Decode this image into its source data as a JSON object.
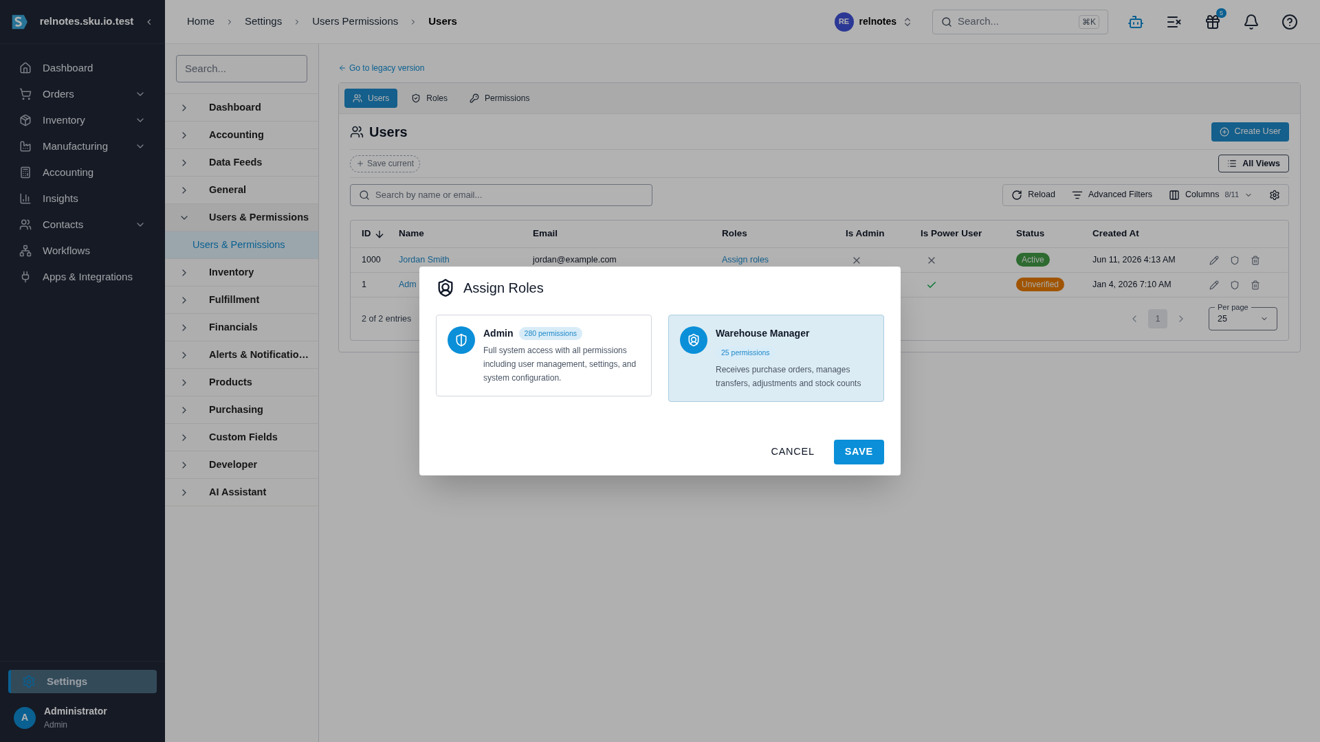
{
  "app": {
    "name": "relnotes.sku.io.test"
  },
  "nav": [
    {
      "label": "Dashboard",
      "has_submenu": false
    },
    {
      "label": "Orders",
      "has_submenu": true
    },
    {
      "label": "Inventory",
      "has_submenu": true
    },
    {
      "label": "Manufacturing",
      "has_submenu": true
    },
    {
      "label": "Accounting",
      "has_submenu": false
    },
    {
      "label": "Insights",
      "has_submenu": false
    },
    {
      "label": "Contacts",
      "has_submenu": true
    },
    {
      "label": "Workflows",
      "has_submenu": false
    },
    {
      "label": "Apps & Integrations",
      "has_submenu": false
    }
  ],
  "settings_nav": {
    "label": "Settings",
    "selected": true
  },
  "user": {
    "initial": "A",
    "name": "Administrator",
    "role": "Admin"
  },
  "breadcrumbs": [
    "Home",
    "Settings",
    "Users Permissions",
    "Users"
  ],
  "workspace": {
    "initials": "RE",
    "name": "relnotes"
  },
  "global_search": {
    "placeholder": "Search...",
    "shortcut": "⌘K"
  },
  "gift_badge": "5",
  "settings_menu": {
    "search_placeholder": "Search...",
    "items": [
      {
        "label": "Dashboard",
        "expanded": false
      },
      {
        "label": "Accounting",
        "expanded": false
      },
      {
        "label": "Data Feeds",
        "expanded": false
      },
      {
        "label": "General",
        "expanded": false
      },
      {
        "label": "Users & Permissions",
        "expanded": true,
        "children": [
          {
            "label": "Users & Permissions",
            "selected": true
          }
        ]
      },
      {
        "label": "Inventory",
        "expanded": false
      },
      {
        "label": "Fulfillment",
        "expanded": false
      },
      {
        "label": "Financials",
        "expanded": false
      },
      {
        "label": "Alerts & Notificatio…",
        "expanded": false
      },
      {
        "label": "Products",
        "expanded": false
      },
      {
        "label": "Purchasing",
        "expanded": false
      },
      {
        "label": "Custom Fields",
        "expanded": false
      },
      {
        "label": "Developer",
        "expanded": false
      },
      {
        "label": "AI Assistant",
        "expanded": false
      }
    ]
  },
  "legacy_link": "Go to legacy version",
  "tabs": [
    {
      "label": "Users",
      "selected": true
    },
    {
      "label": "Roles",
      "selected": false
    },
    {
      "label": "Permissions",
      "selected": false
    }
  ],
  "page_title": "Users",
  "create_button": "Create User",
  "save_view": "Save current",
  "views_button": "All Views",
  "table_search_placeholder": "Search by name or email...",
  "toolbar": {
    "reload": "Reload",
    "filters": "Advanced Filters",
    "columns": "Columns",
    "columns_count": "8/11"
  },
  "table": {
    "columns": [
      {
        "label": "ID",
        "sorted": true
      },
      {
        "label": "Name",
        "sorted": false
      },
      {
        "label": "Email",
        "sorted": false
      },
      {
        "label": "Roles",
        "sorted": false
      },
      {
        "label": "Is Admin",
        "sorted": false
      },
      {
        "label": "Is Power User",
        "sorted": false
      },
      {
        "label": "Status",
        "sorted": false
      },
      {
        "label": "Created At",
        "sorted": false
      }
    ],
    "rows": [
      {
        "id": "1000",
        "name": "Jordan Smith",
        "email": "jordan@example.com",
        "roles": "Assign roles",
        "is_admin": false,
        "is_power_user": false,
        "status": "Active",
        "color": "#2d6b30",
        "created_at": "Jun 11, 2026 4:13 AM"
      },
      {
        "id": "1",
        "name": "Adm",
        "is_power_user": true,
        "status": "Unverified",
        "color": "#a05400",
        "created_at": "Jan 4, 2026 7:10 AM"
      }
    ],
    "entries": "2 of 2 entries",
    "pages": [
      {
        "label": "1",
        "selected": true
      }
    ],
    "per_page": {
      "label": "Per page",
      "value": "25"
    }
  },
  "modal": {
    "title": "Assign Roles",
    "roles": [
      {
        "name": "Admin",
        "permissions": "280 permissions",
        "description": "Full system access with all permissions including user management, settings, and system configuration.",
        "selected": false
      },
      {
        "name": "Warehouse Manager",
        "permissions": "25 permissions",
        "description": "Receives purchase orders, manages transfers, adjustments and stock counts",
        "selected": true
      }
    ],
    "cancel": "CANCEL",
    "save": "SAVE"
  }
}
